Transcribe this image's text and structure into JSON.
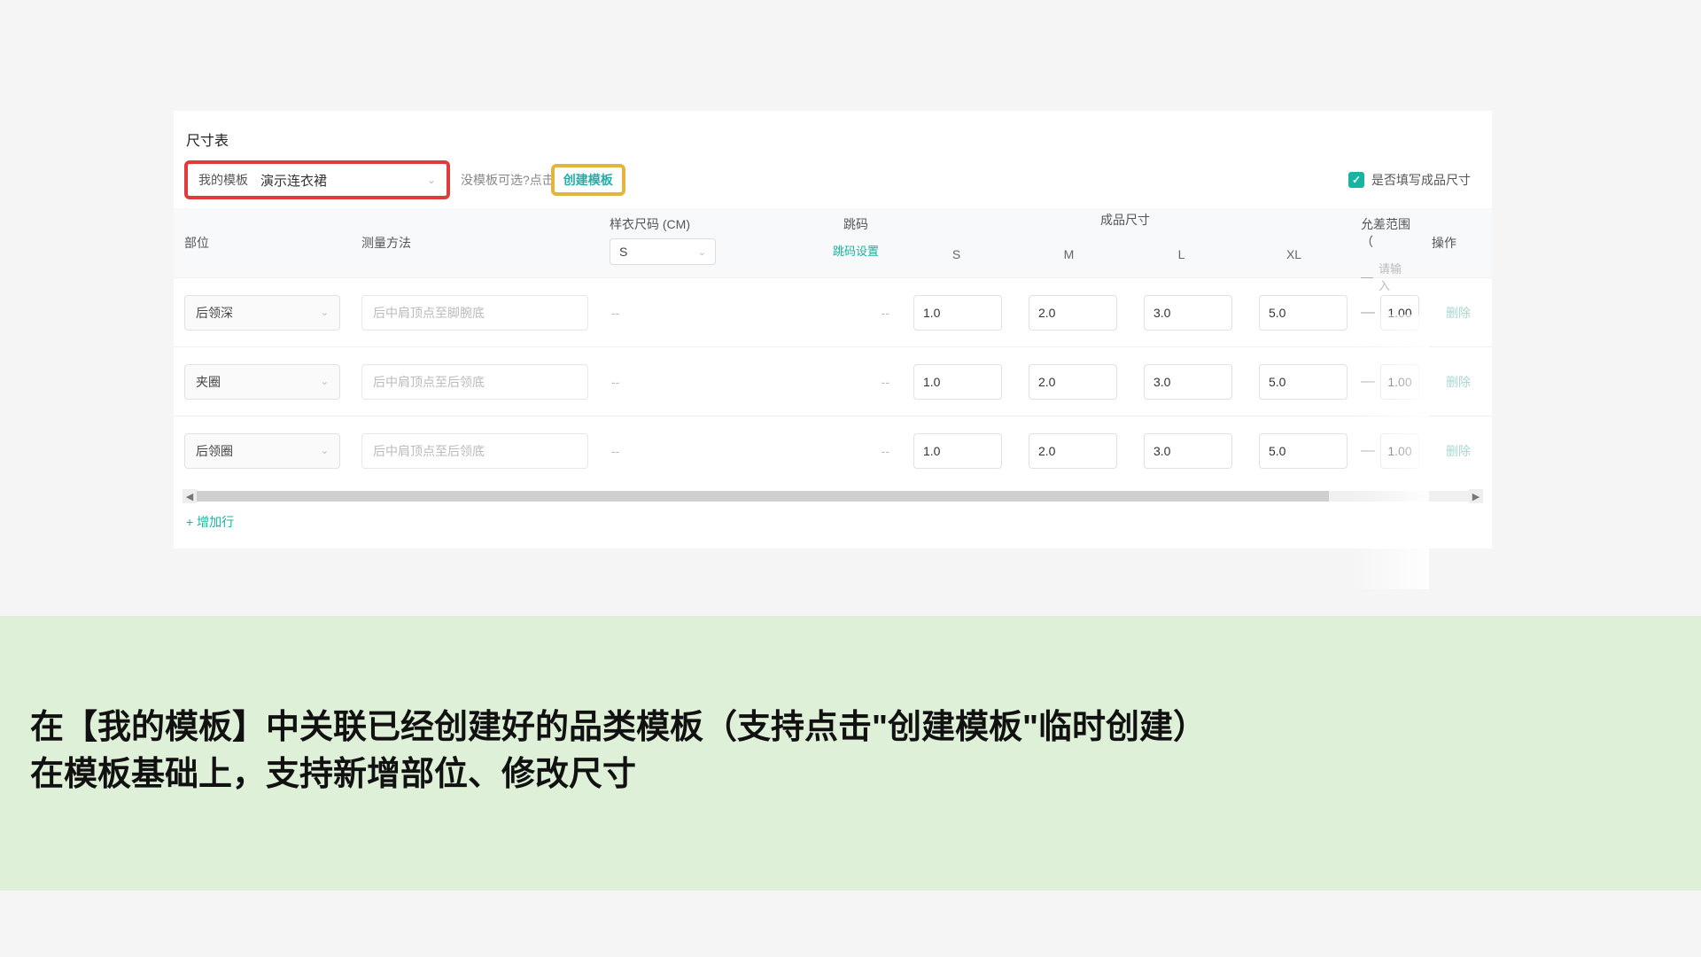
{
  "section_title": "尺寸表",
  "template_dd": {
    "label": "我的模板",
    "value": "演示连衣裙"
  },
  "hint_prefix": "没模板可选?点击",
  "create_btn": "创建模板",
  "checkbox_label": "是否填写成品尺寸",
  "headers": {
    "part": "部位",
    "method": "测量方法",
    "sample": "样衣尺码 (CM)",
    "sample_value": "S",
    "jump_code": "跳码",
    "jump_setting": "跳码设置",
    "finished": "成品尺寸",
    "tolerance": "允差范围（",
    "action": "操作",
    "tol_placeholder": "请输入",
    "sizes": {
      "s": "S",
      "m": "M",
      "l": "L",
      "xl": "XL"
    }
  },
  "rows": [
    {
      "part": "后领深",
      "method_ph": "后中肩顶点至脚腕底",
      "s": "1.0",
      "m": "2.0",
      "l": "3.0",
      "xl": "5.0",
      "tol": "1.00",
      "del": "删除"
    },
    {
      "part": "夹圈",
      "method_ph": "后中肩顶点至后领底",
      "s": "1.0",
      "m": "2.0",
      "l": "3.0",
      "xl": "5.0",
      "tol": "1.00",
      "del": "删除"
    },
    {
      "part": "后领圈",
      "method_ph": "后中肩顶点至后领底",
      "s": "1.0",
      "m": "2.0",
      "l": "3.0",
      "xl": "5.0",
      "tol": "1.00",
      "del": "删除"
    }
  ],
  "add_row": "增加行",
  "caption_line1": "在【我的模板】中关联已经创建好的品类模板（支持点击\"创建模板\"临时创建）",
  "caption_line2": "在模板基础上，支持新增部位、修改尺寸"
}
